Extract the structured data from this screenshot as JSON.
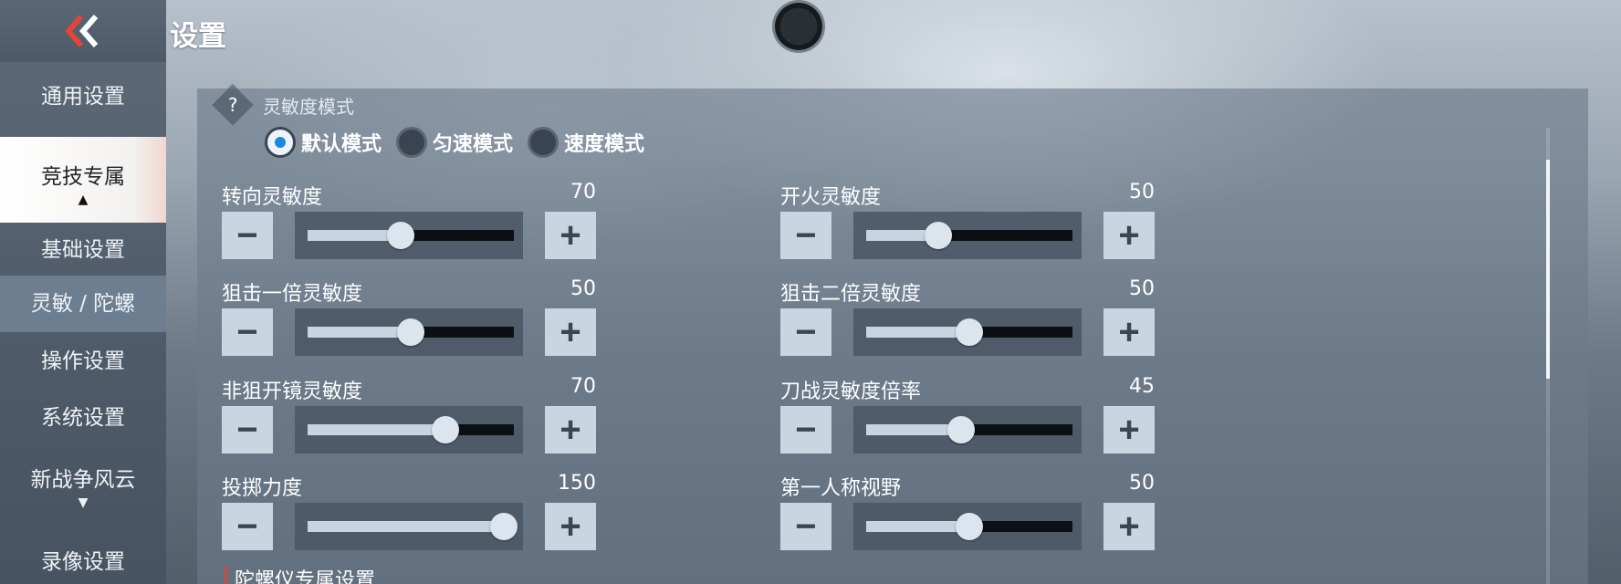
{
  "header": {
    "title": "设置",
    "back_icon": "double-chevron-left-icon",
    "accent": "#e0443b"
  },
  "sidebar": {
    "items": [
      {
        "label": "通用设置",
        "state": "normal"
      },
      {
        "label": "竞技专属",
        "state": "active",
        "caret": "▲"
      },
      {
        "label": "基础设置",
        "state": "normal"
      },
      {
        "label": "灵敏 / 陀螺",
        "state": "sub-active"
      },
      {
        "label": "操作设置",
        "state": "normal"
      },
      {
        "label": "系统设置",
        "state": "normal"
      },
      {
        "label": "新战争风云",
        "state": "normal",
        "caret": "▼"
      },
      {
        "label": "录像设置",
        "state": "normal"
      }
    ]
  },
  "sensitivity_mode": {
    "help_glyph": "?",
    "title": "灵敏度模式",
    "options": [
      {
        "label": "默认模式",
        "selected": true
      },
      {
        "label": "匀速模式",
        "selected": false
      },
      {
        "label": "速度模式",
        "selected": false
      }
    ]
  },
  "settings": [
    {
      "label": "转向灵敏度",
      "value": "70",
      "fraction": 0.45
    },
    {
      "label": "开火灵敏度",
      "value": "50",
      "fraction": 0.35
    },
    {
      "label": "狙击一倍灵敏度",
      "value": "50",
      "fraction": 0.5
    },
    {
      "label": "狙击二倍灵敏度",
      "value": "50",
      "fraction": 0.5
    },
    {
      "label": "非狙开镜灵敏度",
      "value": "70",
      "fraction": 0.67
    },
    {
      "label": "刀战灵敏度倍率",
      "value": "45",
      "fraction": 0.46
    },
    {
      "label": "投掷力度",
      "value": "150",
      "fraction": 0.95
    },
    {
      "label": "第一人称视野",
      "value": "50",
      "fraction": 0.5
    }
  ],
  "controls": {
    "minus": "−",
    "plus": "+"
  },
  "next_section": {
    "title": "陀螺仪专属设置"
  }
}
